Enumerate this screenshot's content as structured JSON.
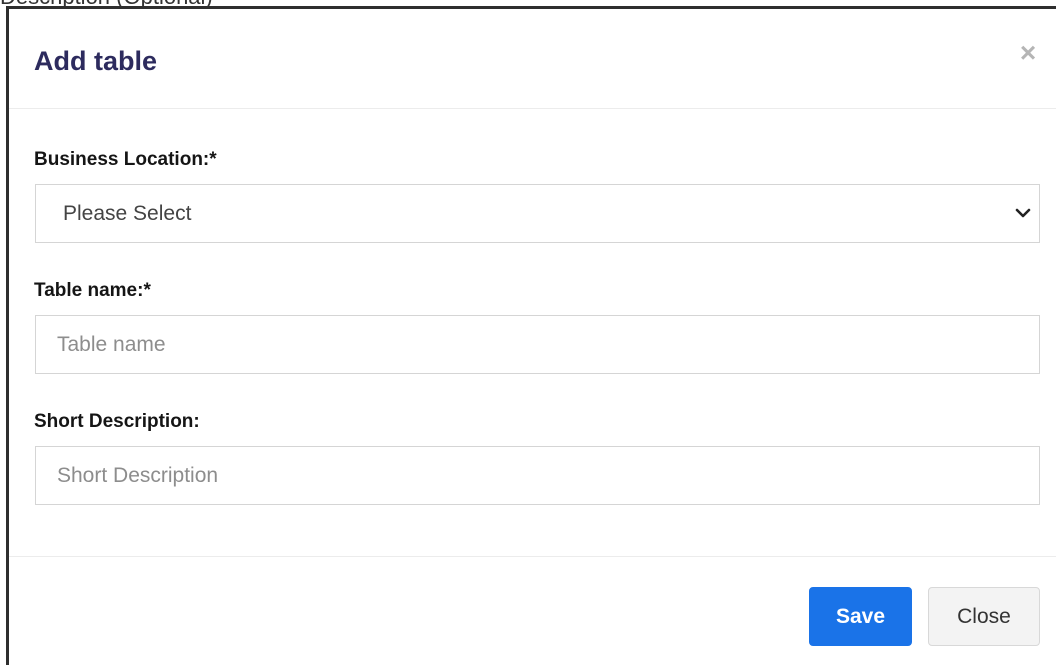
{
  "background": {
    "partial_text": "Description (Optional)"
  },
  "modal": {
    "title": "Add table",
    "close_icon": "×"
  },
  "form": {
    "business_location": {
      "label": "Business Location:*",
      "selected": "Please Select"
    },
    "table_name": {
      "label": "Table name:*",
      "placeholder": "Table name",
      "value": ""
    },
    "short_description": {
      "label": "Short Description:",
      "placeholder": "Short Description",
      "value": ""
    }
  },
  "footer": {
    "save_label": "Save",
    "close_label": "Close"
  },
  "colors": {
    "title": "#2d2b5e",
    "primary": "#1a73e8",
    "secondary_bg": "#f3f3f3"
  }
}
